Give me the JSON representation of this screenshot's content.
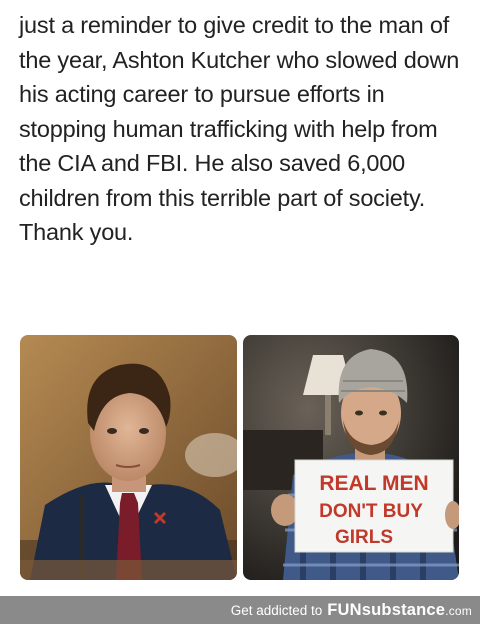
{
  "post": {
    "text": "just a reminder to give credit to the man of the year, Ashton Kutcher who slowed down his acting career to pursue efforts in stopping human trafficking with help from the CIA and FBI. He also saved 6,000 children from this terrible part of society. Thank you."
  },
  "photos": {
    "right": {
      "sign_line1": "REAL MEN",
      "sign_line2": "DON'T BUY",
      "sign_line3": "GIRLS"
    }
  },
  "footer": {
    "tagline": "Get addicted to",
    "brand_main": "FUNsubstance",
    "brand_suffix": ".com"
  },
  "colors": {
    "text": "#222222",
    "footer_bg": "#8a8a8a",
    "sign_text": "#c0392b"
  }
}
